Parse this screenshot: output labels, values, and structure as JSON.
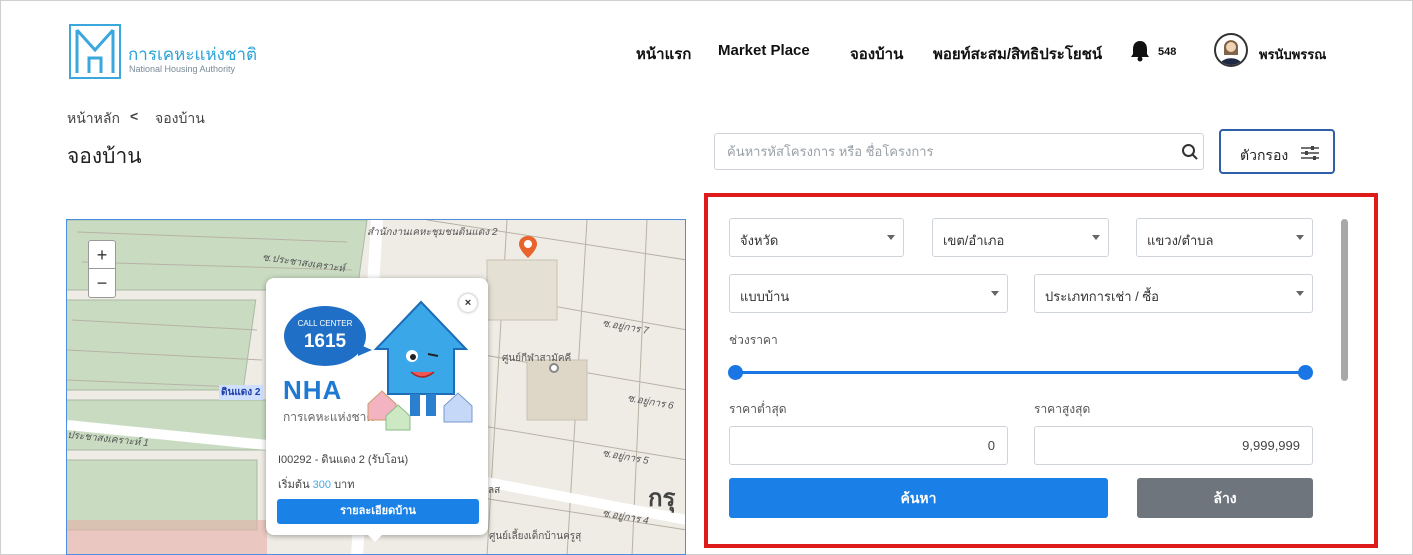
{
  "brand": {
    "name_th": "การเคหะแห่งชาติ",
    "name_en": "National Housing Authority"
  },
  "nav": {
    "home": "หน้าแรก",
    "market": "Market Place",
    "booking": "จองบ้าน",
    "points": "พอยท์สะสม/สิทธิประโยชน์"
  },
  "notifications": {
    "count": "548",
    "icon": "bell-icon"
  },
  "user": {
    "name": "พรนับพรรณ"
  },
  "breadcrumb": {
    "root": "หน้าหลัก",
    "separator": "<",
    "current": "จองบ้าน"
  },
  "page": {
    "title": "จองบ้าน"
  },
  "search": {
    "placeholder": "ค้นหารหัสโครงการ หรือ ชื่อโครงการ",
    "value": ""
  },
  "filter_button": {
    "label": "ตัวกรอง"
  },
  "map": {
    "zoom_in": "+",
    "zoom_out": "−",
    "labels": {
      "office": "สำนักงานเคหะชุมชนดินแดง 2",
      "soi_1": "ซ.ประชาสงเคราะห์",
      "soi_2": "ซ.อยู่การ 7",
      "soi_3": "ซ.อยู่การ 6",
      "soi_4": "ซ.อยู่การ 5",
      "soi_5": "ซ.อยู่การ 4",
      "street_1": "ประชาสงเคราะห์ 1",
      "center": "ศูนย์กีฬาสามัคคี",
      "district_tag": "ดินแดง 2",
      "bangkok": "กรุ",
      "bottom": "ศูนย์เลี้ยงเด็กบ้านครูสุ",
      "near": "ลส"
    }
  },
  "popup": {
    "close": "×",
    "call_center_label": "CALL CENTER",
    "call_center_number": "1615",
    "logo_text": "NHA",
    "logo_sub": "การเคหะแห่งชาติ",
    "project_name": "I00292 - ดินแดง 2 (รับโอน)",
    "price_prefix": "เริ่มต้น",
    "price_value": "300",
    "price_unit": "บาท",
    "detail_button": "รายละเอียดบ้าน"
  },
  "filters": {
    "province": "จังหวัด",
    "district": "เขต/อำเภอ",
    "subdistrict": "แขวง/ตำบล",
    "house_type": "แบบบ้าน",
    "deal_type": "ประเภทการเช่า / ซื้อ",
    "price_range_label": "ช่วงราคา",
    "price_range_fraction": {
      "min": 0,
      "max": 1
    },
    "min_price_label": "ราคาต่ำสุด",
    "max_price_label": "ราคาสูงสุด",
    "min_price_value": "0",
    "max_price_value": "9,999,999",
    "search_button": "ค้นหา",
    "clear_button": "ล้าง"
  },
  "colors": {
    "brand": "#2ba3d8",
    "primary": "#1a7fe6",
    "highlight": "#de1a1a",
    "secondary": "#6e757d"
  }
}
